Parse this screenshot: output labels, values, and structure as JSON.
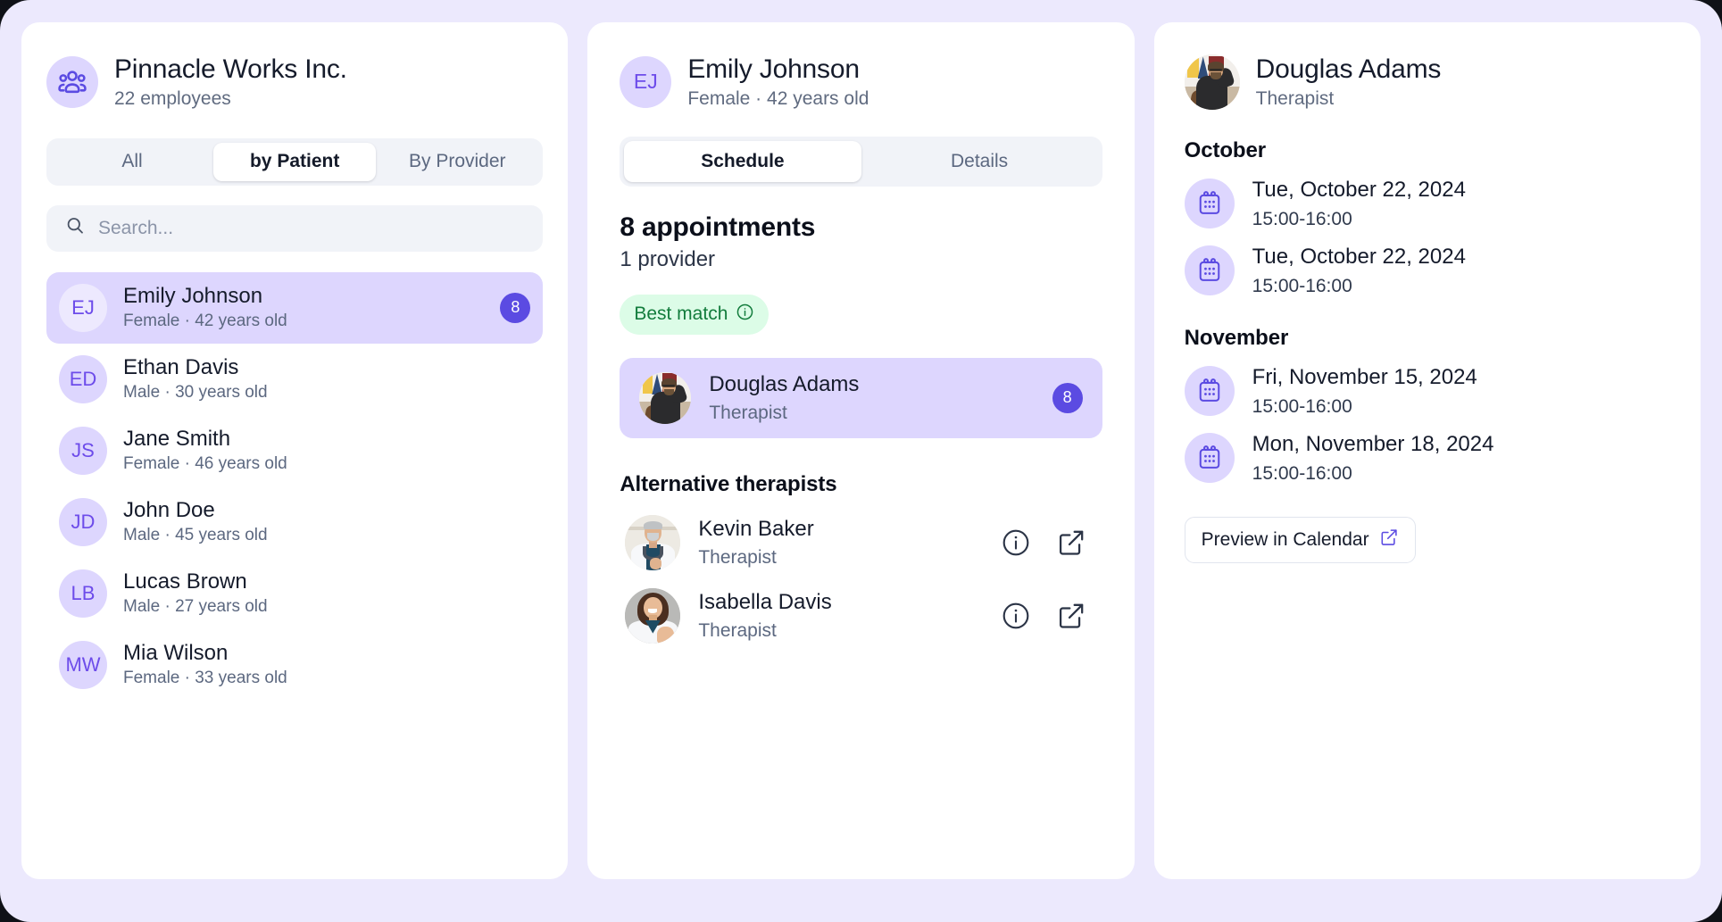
{
  "left_panel": {
    "org": {
      "icon": "users-group-icon",
      "name": "Pinnacle Works Inc.",
      "subtitle": "22 employees"
    },
    "segmented": {
      "options": [
        "All",
        "by Patient",
        "By Provider"
      ],
      "selected": "by Patient"
    },
    "search": {
      "icon": "search-icon",
      "placeholder": "Search...",
      "value": ""
    },
    "patients": [
      {
        "initials": "EJ",
        "name": "Emily Johnson",
        "meta": "Female · 42 years old",
        "badge": "8",
        "selected": true
      },
      {
        "initials": "ED",
        "name": "Ethan Davis",
        "meta": "Male · 30 years old",
        "badge": "",
        "selected": false
      },
      {
        "initials": "JS",
        "name": "Jane Smith",
        "meta": "Female · 46 years old",
        "badge": "",
        "selected": false
      },
      {
        "initials": "JD",
        "name": "John Doe",
        "meta": "Male · 45 years old",
        "badge": "",
        "selected": false
      },
      {
        "initials": "LB",
        "name": "Lucas Brown",
        "meta": "Male · 27 years old",
        "badge": "",
        "selected": false
      },
      {
        "initials": "MW",
        "name": "Mia Wilson",
        "meta": "Female · 33 years old",
        "badge": "",
        "selected": false
      }
    ]
  },
  "middle_panel": {
    "patient": {
      "initials": "EJ",
      "name": "Emily Johnson",
      "meta": "Female · 42 years old"
    },
    "tabs": {
      "options": [
        "Schedule",
        "Details"
      ],
      "selected": "Schedule"
    },
    "summary": {
      "appointments": "8 appointments",
      "providers": "1 provider"
    },
    "best_match": {
      "label": "Best match",
      "icon": "info-circle-icon"
    },
    "assigned_provider": {
      "photo": "douglas-adams-photo",
      "name": "Douglas Adams",
      "role": "Therapist",
      "badge": "8"
    },
    "alternatives_title": "Alternative therapists",
    "alternatives": [
      {
        "photo": "kevin-baker-photo",
        "name": "Kevin Baker",
        "role": "Therapist",
        "info_icon": "info-circle-icon",
        "open_icon": "external-link-icon"
      },
      {
        "photo": "isabella-davis-photo",
        "name": "Isabella Davis",
        "role": "Therapist",
        "info_icon": "info-circle-icon",
        "open_icon": "external-link-icon"
      }
    ]
  },
  "right_panel": {
    "provider": {
      "photo": "douglas-adams-photo",
      "name": "Douglas Adams",
      "role": "Therapist"
    },
    "months": [
      {
        "title": "October",
        "appointments": [
          {
            "icon": "calendar-icon",
            "date": "Tue, October 22, 2024",
            "time": "15:00-16:00"
          },
          {
            "icon": "calendar-icon",
            "date": "Tue, October 22, 2024",
            "time": "15:00-16:00"
          }
        ]
      },
      {
        "title": "November",
        "appointments": [
          {
            "icon": "calendar-icon",
            "date": "Fri, November 15, 2024",
            "time": "15:00-16:00"
          },
          {
            "icon": "calendar-icon",
            "date": "Mon, November 18, 2024",
            "time": "15:00-16:00"
          }
        ]
      }
    ],
    "preview_button": {
      "label": "Preview in Calendar",
      "icon": "external-link-icon"
    }
  },
  "colors": {
    "page_background": "#ECE9FD",
    "card_background": "#FFFFFF",
    "accent_indigo": "#5B4BE2",
    "accent_lavender": "#DDD6FE",
    "accent_lavender_pale": "#EDE9FE",
    "neutral_field": "#F1F3F8",
    "text_primary": "#151B2B",
    "text_secondary": "#5C6880",
    "badge_green_bg": "#DCFCE7",
    "badge_green_text": "#127C3C"
  }
}
